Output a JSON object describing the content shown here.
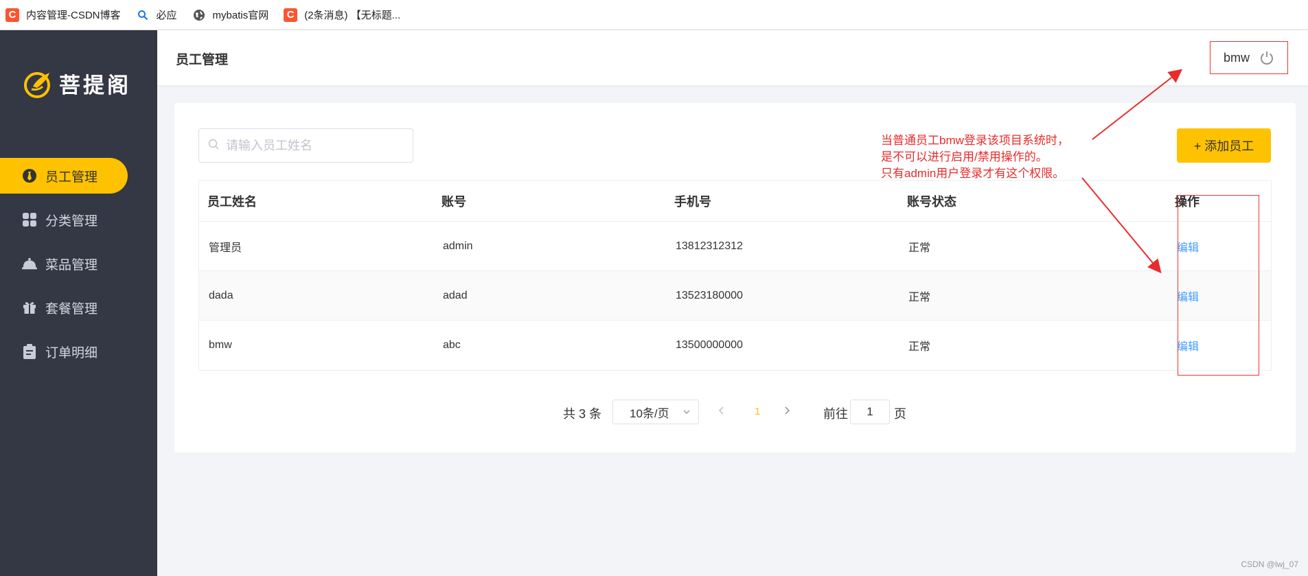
{
  "bookmarks": [
    {
      "label": "内容管理-CSDN博客",
      "icon": "csdn-icon"
    },
    {
      "label": "必应",
      "icon": "bing-search-icon"
    },
    {
      "label": "mybatis官网",
      "icon": "globe-icon"
    },
    {
      "label": "(2条消息) 【无标题...",
      "icon": "csdn-icon"
    }
  ],
  "sidebar": {
    "logo_text": "菩提阁",
    "items": [
      {
        "label": "员工管理",
        "icon": "tie-icon",
        "active": true
      },
      {
        "label": "分类管理",
        "icon": "grid-icon",
        "active": false
      },
      {
        "label": "菜品管理",
        "icon": "cloche-icon",
        "active": false
      },
      {
        "label": "套餐管理",
        "icon": "gift-icon",
        "active": false
      },
      {
        "label": "订单明细",
        "icon": "clipboard-icon",
        "active": false
      }
    ]
  },
  "header": {
    "title": "员工管理",
    "username": "bmw"
  },
  "toolbar": {
    "search_placeholder": "请输入员工姓名",
    "add_label": "+ 添加员工"
  },
  "table": {
    "columns": [
      "员工姓名",
      "账号",
      "手机号",
      "账号状态",
      "操作"
    ],
    "rows": [
      {
        "name": "管理员",
        "account": "admin",
        "phone": "13812312312",
        "status": "正常",
        "action": "编辑"
      },
      {
        "name": "dada",
        "account": "adad",
        "phone": "13523180000",
        "status": "正常",
        "action": "编辑"
      },
      {
        "name": "bmw",
        "account": "abc",
        "phone": "13500000000",
        "status": "正常",
        "action": "编辑"
      }
    ]
  },
  "pagination": {
    "total": "共 3 条",
    "page_size": "10条/页",
    "current_page": "1",
    "goto_label": "前往",
    "goto_value": "1",
    "page_unit": "页"
  },
  "annotation": {
    "line1": "当普通员工bmw登录该项目系统时，",
    "line2": "是不可以进行启用/禁用操作的。",
    "line3": "只有admin用户登录才有这个权限。"
  },
  "watermark": "CSDN @lwj_07",
  "colors": {
    "accent": "#ffc200",
    "sidebar_bg": "#343744",
    "link": "#419eff",
    "annotation": "#e82c2c"
  }
}
